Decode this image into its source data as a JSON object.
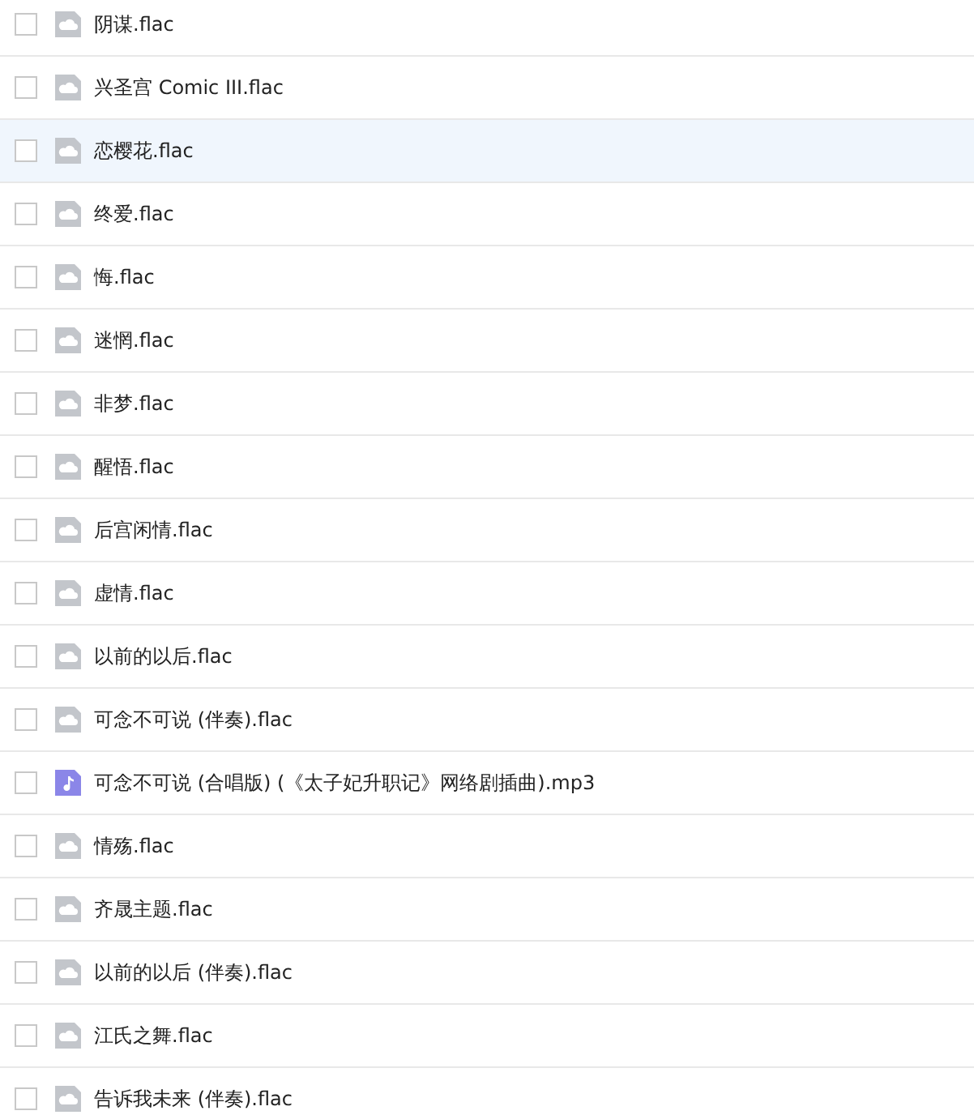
{
  "files": [
    {
      "name": "阴谋.flac",
      "kind": "cloud",
      "checked": false,
      "highlighted": false
    },
    {
      "name": "兴圣宫 Comic III.flac",
      "kind": "cloud",
      "checked": false,
      "highlighted": false
    },
    {
      "name": "恋樱花.flac",
      "kind": "cloud",
      "checked": false,
      "highlighted": true
    },
    {
      "name": "终爱.flac",
      "kind": "cloud",
      "checked": false,
      "highlighted": false
    },
    {
      "name": "悔.flac",
      "kind": "cloud",
      "checked": false,
      "highlighted": false
    },
    {
      "name": "迷惘.flac",
      "kind": "cloud",
      "checked": false,
      "highlighted": false
    },
    {
      "name": "非梦.flac",
      "kind": "cloud",
      "checked": false,
      "highlighted": false
    },
    {
      "name": "醒悟.flac",
      "kind": "cloud",
      "checked": false,
      "highlighted": false
    },
    {
      "name": "后宫闲情.flac",
      "kind": "cloud",
      "checked": false,
      "highlighted": false
    },
    {
      "name": "虚情.flac",
      "kind": "cloud",
      "checked": false,
      "highlighted": false
    },
    {
      "name": "以前的以后.flac",
      "kind": "cloud",
      "checked": false,
      "highlighted": false
    },
    {
      "name": "可念不可说 (伴奏).flac",
      "kind": "cloud",
      "checked": false,
      "highlighted": false
    },
    {
      "name": "可念不可说 (合唱版) (《太子妃升职记》网络剧插曲).mp3",
      "kind": "music",
      "checked": false,
      "highlighted": false
    },
    {
      "name": "情殇.flac",
      "kind": "cloud",
      "checked": false,
      "highlighted": false
    },
    {
      "name": "齐晟主题.flac",
      "kind": "cloud",
      "checked": false,
      "highlighted": false
    },
    {
      "name": "以前的以后 (伴奏).flac",
      "kind": "cloud",
      "checked": false,
      "highlighted": false
    },
    {
      "name": "江氏之舞.flac",
      "kind": "cloud",
      "checked": false,
      "highlighted": false
    },
    {
      "name": "告诉我未来 (伴奏).flac",
      "kind": "cloud",
      "checked": false,
      "highlighted": false
    }
  ]
}
